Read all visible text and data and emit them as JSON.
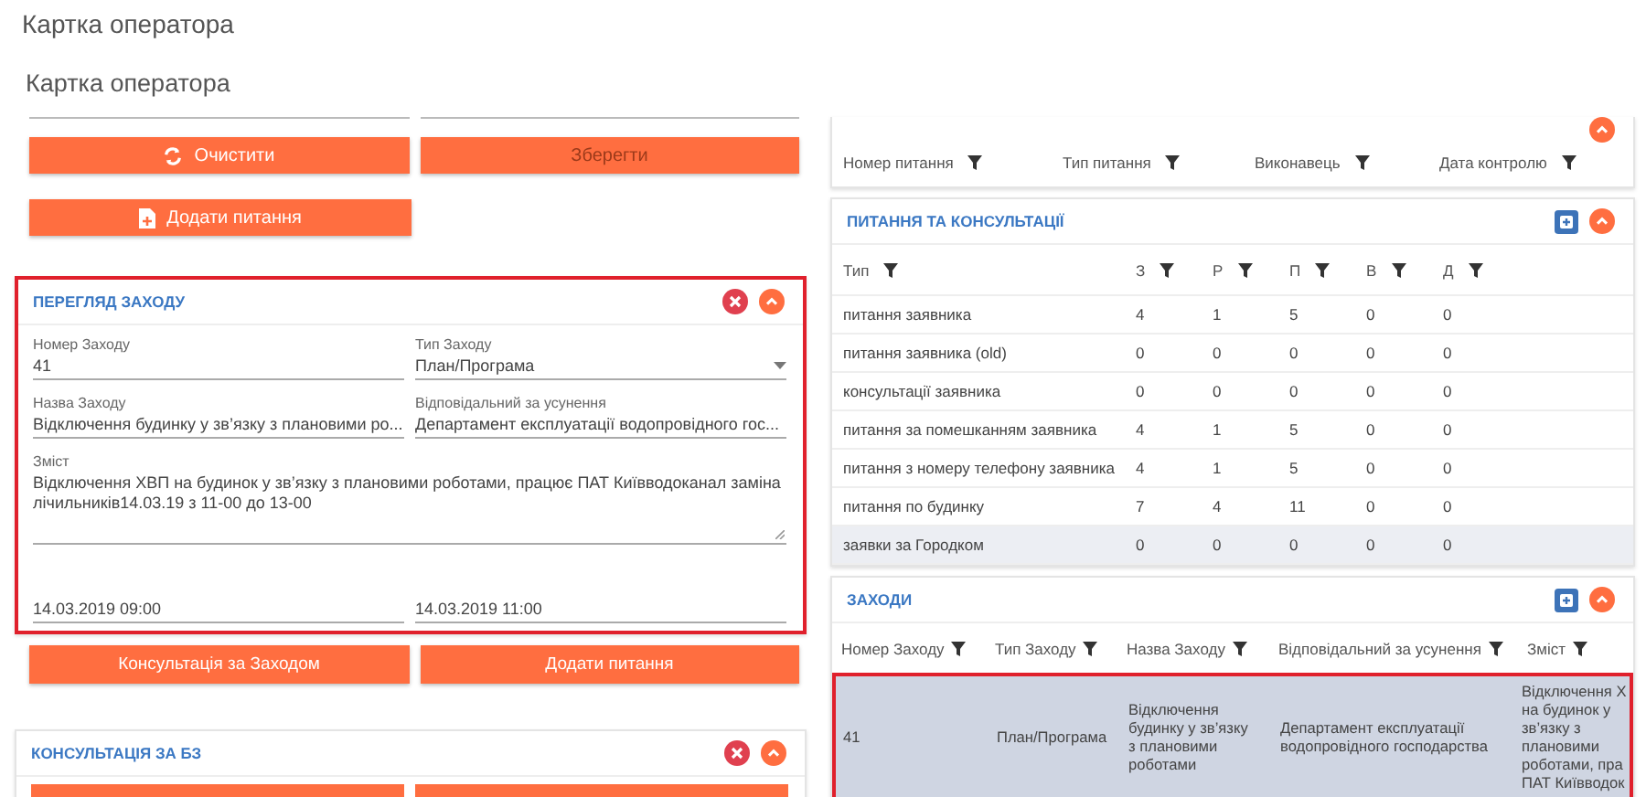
{
  "title": "Картка оператора",
  "left": {
    "subtitle": "Картка оператора",
    "buttons": [
      {
        "label": "Очистити",
        "disabled": false
      },
      {
        "label": "Зберегти",
        "disabled": true
      }
    ],
    "add_button": {
      "label": "Додати питання"
    },
    "event_panel": {
      "title": "ПЕРЕГЛЯД ЗАХОДУ",
      "highlighted": true,
      "fields": [
        {
          "kind": "text",
          "label": "Номер Заходу",
          "value": "41"
        },
        {
          "kind": "select",
          "label": "Тип Заходу",
          "value": "План/Програма"
        },
        {
          "kind": "text",
          "label": "Назва Заходу",
          "value": "Відключення будинку у зв’язку з плановими ро..."
        },
        {
          "kind": "text",
          "label": "Відповідальний за усунення",
          "value": "Департамент експлуатації водопровідного гос..."
        },
        {
          "kind": "textarea",
          "label": "Зміст",
          "value": "Відключення ХВП на будинок у зв’язку з плановими роботами, працює ПАТ Київводоканал заміна лічильників14.03.19 з 11-00 до 13-00"
        },
        {
          "kind": "text",
          "value": "14.03.2019 09:00"
        },
        {
          "kind": "text",
          "value": "14.03.2019 11:00"
        }
      ],
      "buttons": [
        "Консультація за Заходом",
        "Додати питання"
      ]
    },
    "kb_panel": {
      "title": "КОНСУЛЬТАЦІЯ ЗА БЗ"
    }
  },
  "right": {
    "questions_table": {
      "columns": [
        "Номер питання",
        "Тип питання",
        "Виконавець",
        "Дата контролю"
      ]
    },
    "consult_panel": {
      "title": "ПИТАННЯ ТА КОНСУЛЬТАЦІЇ",
      "columns": [
        "Тип",
        "З",
        "Р",
        "П",
        "В",
        "Д"
      ],
      "rows": [
        {
          "hovered": false,
          "cells": [
            "питання заявника",
            "4",
            "1",
            "5",
            "0",
            "0"
          ]
        },
        {
          "hovered": false,
          "cells": [
            "питання заявника (old)",
            "0",
            "0",
            "0",
            "0",
            "0"
          ]
        },
        {
          "hovered": false,
          "cells": [
            "консультації заявника",
            "0",
            "0",
            "0",
            "0",
            "0"
          ]
        },
        {
          "hovered": false,
          "cells": [
            "питання за помешканням заявника",
            "4",
            "1",
            "5",
            "0",
            "0"
          ]
        },
        {
          "hovered": false,
          "cells": [
            "питання з номеру телефону заявника",
            "4",
            "1",
            "5",
            "0",
            "0"
          ]
        },
        {
          "hovered": false,
          "cells": [
            "питання по будинку",
            "7",
            "4",
            "11",
            "0",
            "0"
          ]
        },
        {
          "hovered": true,
          "cells": [
            "заявки за Городком",
            "0",
            "0",
            "0",
            "0",
            "0"
          ]
        }
      ]
    },
    "events_panel": {
      "title": "ЗАХОДИ",
      "columns": [
        "Номер Заходу",
        "Тип Заходу",
        "Назва Заходу",
        "Відповідальний за усунення",
        "Зміст"
      ],
      "rows": [
        {
          "selected": true,
          "cells": [
            "41",
            "План/Програма",
            "Відключення будинку у зв’язку з плановими роботами",
            "Департамент експлуатації водопровідного господарства",
            "Відключення Х на будинок у зв’язку з плановими роботами, пра ПАТ Київводок"
          ]
        }
      ]
    }
  }
}
